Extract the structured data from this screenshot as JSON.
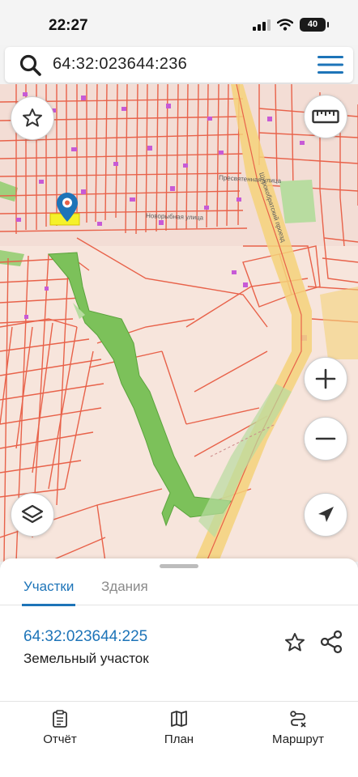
{
  "status": {
    "time": "22:27",
    "battery": "40"
  },
  "search": {
    "query": "64:32:023644:236"
  },
  "map": {
    "street_labels": [
      "Пресвятенная улица",
      "Новорыбная улица",
      "Широкобратский проезд"
    ],
    "colors": {
      "parcel": "#e8624a",
      "background": "#f7e5dc",
      "greenery": "#7cc15a",
      "building": "#c75ad6",
      "road": "#f4d27a"
    }
  },
  "sheet": {
    "tabs": [
      "Участки",
      "Здания"
    ],
    "active_tab": 0,
    "result": {
      "cadastral_number": "64:32:023644:225",
      "type": "Земельный участок"
    }
  },
  "bottom_nav": {
    "items": [
      {
        "label": "Отчёт",
        "icon": "report-icon"
      },
      {
        "label": "План",
        "icon": "map-plan-icon"
      },
      {
        "label": "Маршрут",
        "icon": "route-icon"
      }
    ]
  },
  "accent_color": "#1d74b8"
}
